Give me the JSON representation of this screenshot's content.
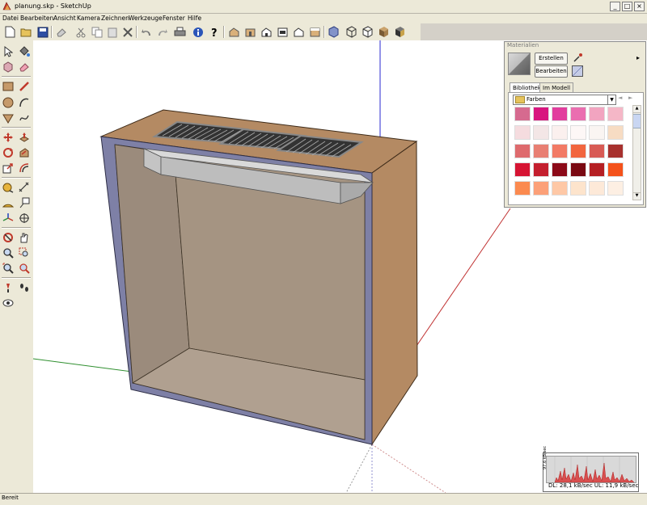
{
  "window": {
    "title": "planung.skp - SketchUp"
  },
  "menu": [
    "Datei",
    "Bearbeiten",
    "Ansicht",
    "Kamera",
    "Zeichnen",
    "Werkzeuge",
    "Fenster",
    "Hilfe"
  ],
  "window_controls": {
    "minimize": "_",
    "maximize": "□",
    "close": "×"
  },
  "materials": {
    "title": "Materialien",
    "create_label": "Erstellen",
    "edit_label": "Bearbeiten",
    "tabs": [
      "Bibliothek",
      "Im Modell"
    ],
    "active_tab": "Bibliothek",
    "library_value": "Farben",
    "swatches": [
      [
        "#d66a8f",
        "#d8157f",
        "#e23d9e",
        "#ea6eb0",
        "#f2a4c0",
        "#f5b7c7"
      ],
      [
        "#f5dcdf",
        "#f3e6e6",
        "#fbf0ee",
        "#fdf7f6",
        "#faf5f2",
        "#f7dcc3"
      ],
      [
        "#de6a6d",
        "#e87f73",
        "#f27a65",
        "#f2663f",
        "#d85b55",
        "#a7312e"
      ],
      [
        "#d61433",
        "#c41f2e",
        "#8c0a18",
        "#7a0912",
        "#b51f23",
        "#f4521b"
      ],
      [
        "#fb8a4f",
        "#fca078",
        "#fec8a6",
        "#fde4cc",
        "#fde9d8",
        "#fdefe3"
      ]
    ]
  },
  "network_monitor": {
    "y_label": "97.6 kB/sec",
    "rate_text": "DL: 28,1 kB/sec  UL: 11,9 kB/sec"
  },
  "status": {
    "text": "Bereit"
  }
}
